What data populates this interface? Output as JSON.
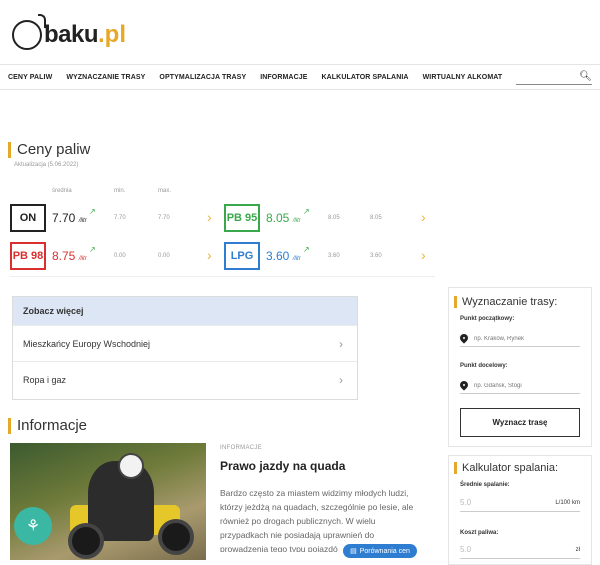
{
  "brand": {
    "name": "baku",
    "tld": ".pl"
  },
  "nav": {
    "items": [
      "CENY PALIW",
      "WYZNACZANIE TRASY",
      "OPTYMALIZACJA TRASY",
      "INFORMACJE",
      "KALKULATOR SPALANIA",
      "WIRTUALNY ALKOMAT"
    ],
    "search_placeholder": ""
  },
  "prices": {
    "title": "Ceny paliw",
    "update": "Aktualizacja (5.06.2022)",
    "headers": {
      "avg": "średnia",
      "min": "min.",
      "max": "max."
    },
    "unit": "/litr",
    "fuels": [
      {
        "name": "ON",
        "color": "#222222",
        "price": "7.70",
        "min": "7.70",
        "max": "7.70",
        "trend": "up"
      },
      {
        "name": "PB 95",
        "color": "#3aa84a",
        "price": "8.05",
        "min": "8.05",
        "max": "8.05",
        "trend": "up"
      },
      {
        "name": "PB 98",
        "color": "#d9302f",
        "price": "8.75",
        "min": "0.00",
        "max": "0.00",
        "trend": "up"
      },
      {
        "name": "LPG",
        "color": "#2f7dd1",
        "price": "3.60",
        "min": "3.60",
        "max": "3.60",
        "trend": "up"
      }
    ]
  },
  "see_more": {
    "title": "Zobacz więcej",
    "items": [
      "Mieszkańcy Europy Wschodniej",
      "Ropa i gaz"
    ]
  },
  "info": {
    "title": "Informacje",
    "category": "INFORMACJE",
    "headline": "Prawo jazdy na quada",
    "text": "Bardzo często za miastem widzimy młodych ludzi, którzy jeżdżą na quadach, szczególnie po lesie, ale również po drogach publicznych. W wielu przypadkach nie posiadają uprawnień do prowadzenia tego typu pojazdó",
    "compare_button": "Porównania cen"
  },
  "route": {
    "title": "Wyznaczanie trasy:",
    "start_label": "Punkt początkowy:",
    "start_placeholder": "np. Kraków, Rynek",
    "end_label": "Punkt docelowy:",
    "end_placeholder": "np. Gdańsk, Stogi",
    "button": "Wyznacz trasę"
  },
  "calc": {
    "title": "Kalkulator spalania:",
    "avg_label": "Średnie spalanie:",
    "avg_value": "5.0",
    "avg_unit": "L/100 km",
    "cost_label": "Koszt paliwa:",
    "cost_value": "5.0",
    "cost_unit": "zł"
  }
}
